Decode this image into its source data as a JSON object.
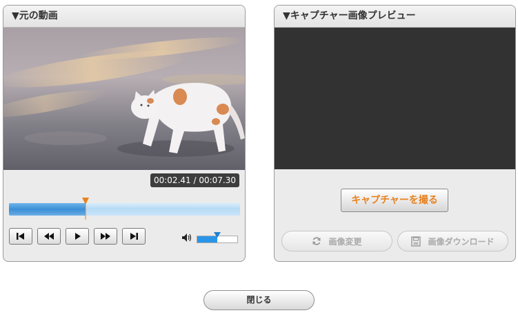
{
  "source_panel": {
    "title": "▼元の動画",
    "time_display": "00:02.41 / 00:07.30",
    "playback_progress": 0.33,
    "volume_level": 0.5,
    "controls": [
      "skip-to-start",
      "rewind",
      "play",
      "fast-forward",
      "skip-to-end"
    ]
  },
  "preview_panel": {
    "title": "▼キャプチャー画像プレビュー",
    "capture_button": "キャプチャーを撮る",
    "change_image_button": "画像変更",
    "download_button": "画像ダウンロード"
  },
  "close_button": "閉じる",
  "colors": {
    "accent_orange": "#e8821f",
    "seek_blue": "#3b8fd6",
    "preview_bg": "#323232"
  }
}
